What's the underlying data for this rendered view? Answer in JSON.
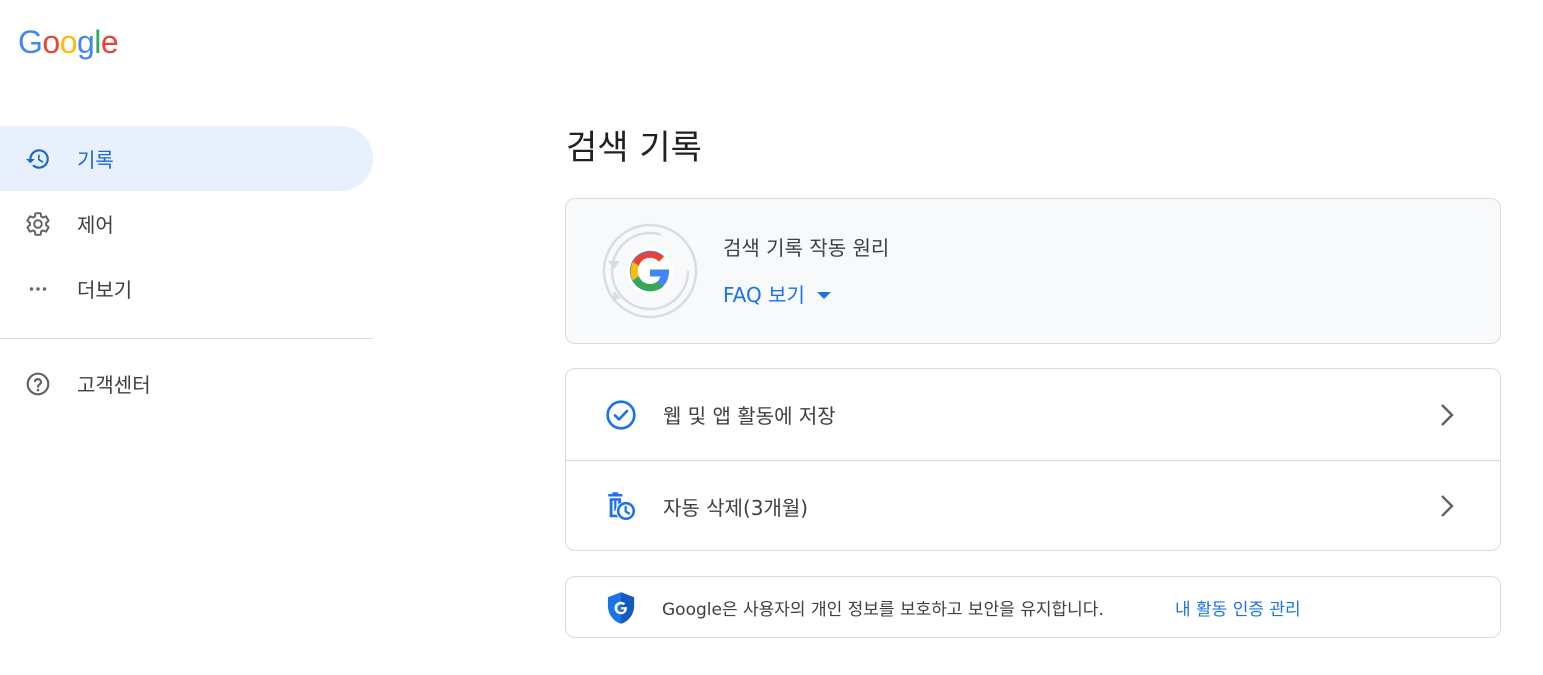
{
  "logo": {
    "letters": [
      "G",
      "o",
      "o",
      "g",
      "l",
      "e"
    ],
    "colors": [
      "#4285f4",
      "#ea4335",
      "#fbbc05",
      "#4285f4",
      "#34a853",
      "#ea4335"
    ]
  },
  "sidebar": {
    "items": [
      {
        "label": "기록",
        "icon": "history-icon",
        "active": true
      },
      {
        "label": "제어",
        "icon": "gear-icon",
        "active": false
      },
      {
        "label": "더보기",
        "icon": "more-horiz-icon",
        "active": false
      }
    ],
    "help": {
      "label": "고객센터",
      "icon": "help-icon"
    }
  },
  "main": {
    "title": "검색 기록",
    "faq": {
      "title": "검색 기록 작동 원리",
      "link": "FAQ 보기"
    },
    "settings": [
      {
        "label": "웹 및 앱 활동에 저장",
        "icon": "check-circle-icon"
      },
      {
        "label": "자동 삭제(3개월)",
        "icon": "auto-delete-icon"
      }
    ],
    "privacy": {
      "text": "Google은 사용자의 개인 정보를 보호하고 보안을 유지합니다.",
      "link": "내 활동 인증 관리",
      "icon": "google-shield-icon"
    }
  },
  "colors": {
    "accent": "#1a73e8",
    "active_bg": "#e8f0fe",
    "card_bg": "#f8f9fa",
    "border": "#dadce0",
    "text": "#3c4043"
  }
}
